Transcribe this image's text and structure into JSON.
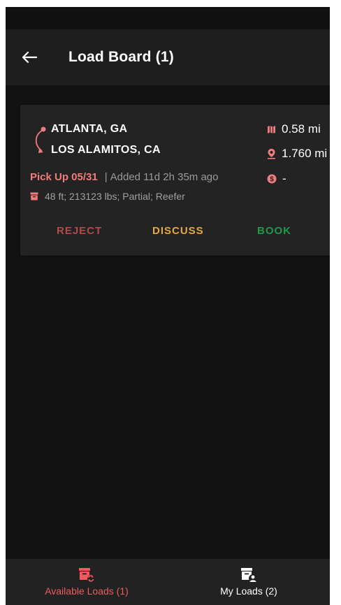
{
  "app_bar": {
    "title": "Load Board (1)",
    "back_icon": "arrow-left-icon"
  },
  "load_card": {
    "origin": "ATLANTA,  GA",
    "destination": "LOS ALAMITOS, CA",
    "route_icon": "route-curve-icon",
    "metrics": [
      {
        "icon": "map-icon",
        "value": "0.58 mi"
      },
      {
        "icon": "location-pin-icon",
        "value": "1.760 mi"
      },
      {
        "icon": "dollar-icon",
        "value": "-"
      }
    ],
    "pickup": "Pick Up 05/31",
    "added": "Added 11d 2h 35m ago",
    "details_icon": "box-icon",
    "details": "48 ft; 213123 lbs; Partial; Reefer",
    "actions": {
      "reject": "REJECT",
      "discuss": "DISCUSS",
      "book": "BOOK"
    }
  },
  "bottom_nav": {
    "items": [
      {
        "label": "Available Loads (1)",
        "icon": "available-loads-icon",
        "active": true
      },
      {
        "label": "My Loads (2)",
        "icon": "my-loads-icon",
        "active": false
      }
    ]
  },
  "colors": {
    "accent": "#ef5b5b",
    "reject": "#b24a4a",
    "discuss": "#e6a940",
    "book": "#1f9a4a",
    "background": "#121212",
    "card": "#232323"
  }
}
